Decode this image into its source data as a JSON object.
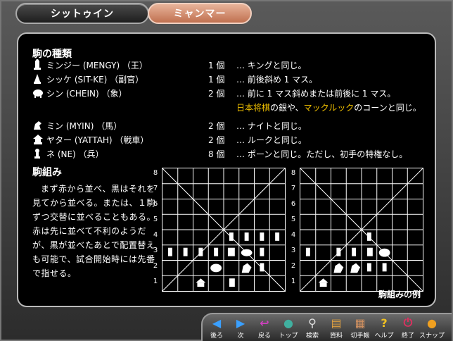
{
  "tabs": [
    {
      "label": "シットゥイン",
      "active": false
    },
    {
      "label": "ミャンマー",
      "active": true
    }
  ],
  "pieces_title": "駒の種類",
  "pieces": [
    {
      "name": "ミンジー (MENGY) （王）",
      "count": "1 個",
      "desc": "… キングと同じ。"
    },
    {
      "name": "シッケ (SIT-KE) （副官）",
      "count": "1 個",
      "desc": "… 前後斜め 1 マス。"
    },
    {
      "name": "シン (CHEIN) （象）",
      "count": "2 個",
      "desc": "… 前に 1 マス斜めまたは前後に 1 マス。"
    },
    {
      "name": "ミン (MYIN) （馬）",
      "count": "2 個",
      "desc": "… ナイトと同じ。"
    },
    {
      "name": "ヤター (YATTAH) （戦車）",
      "count": "2 個",
      "desc": "… ルークと同じ。"
    },
    {
      "name": "ネ (NE) （兵）",
      "count": "8 個",
      "desc": "… ポーンと同じ。ただし、初手の特権なし。"
    }
  ],
  "note": {
    "hl1": "日本将棋",
    "mid": "の銀や、",
    "hl2": "マックルック",
    "end": "のコーンと同じ。"
  },
  "kumi_title": "駒組み",
  "kumi_text": "まず赤から並べ、黒はそれを見てから並べる。または、１駒ずつ交替に並べることもある。赤は先に並べて不利のようだが、黒が並べたあとで配置替えも可能で、試合開始時には先番で指せる。",
  "ranks": [
    "8",
    "7",
    "6",
    "5",
    "4",
    "3",
    "2",
    "1"
  ],
  "caption": "駒組みの例",
  "nav": [
    {
      "label": "後ろ",
      "icon": "left-arrow-icon",
      "color": "#3aa0ff",
      "glyph": "◀"
    },
    {
      "label": "次",
      "icon": "right-arrow-icon",
      "color": "#3aa0ff",
      "glyph": "▶"
    },
    {
      "label": "戻る",
      "icon": "return-icon",
      "color": "#d040c0",
      "glyph": "↩"
    },
    {
      "label": "トップ",
      "icon": "globe-icon",
      "color": "#40b0a0",
      "glyph": "●"
    },
    {
      "label": "検索",
      "icon": "magnifier-icon",
      "color": "#e0e0e0",
      "glyph": "⚲"
    },
    {
      "label": "資料",
      "icon": "book-icon",
      "color": "#e0a040",
      "glyph": "▤"
    },
    {
      "label": "切手帳",
      "icon": "stamp-icon",
      "color": "#d09060",
      "glyph": "▦"
    },
    {
      "label": "ヘルプ",
      "icon": "help-icon",
      "color": "#f0c020",
      "glyph": "?"
    },
    {
      "label": "終了",
      "icon": "power-icon",
      "color": "#e03060",
      "glyph": "⏻"
    },
    {
      "label": "スナップ",
      "icon": "snap-icon",
      "color": "#f0a020",
      "glyph": "●"
    }
  ]
}
